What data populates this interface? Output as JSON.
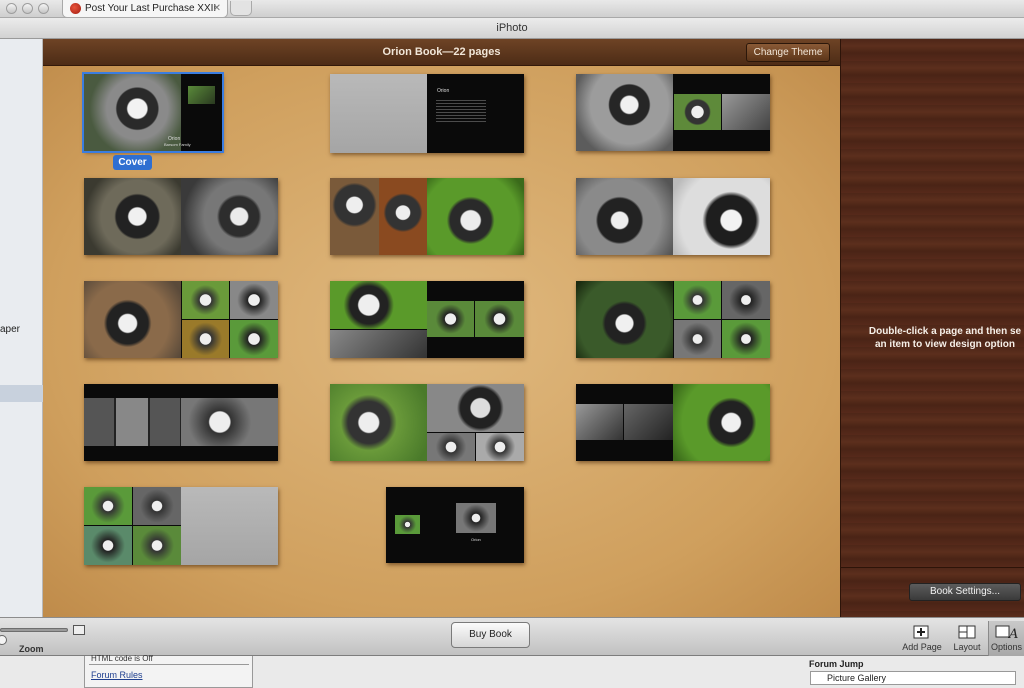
{
  "browser": {
    "tab_title": "Post Your Last Purchase XXII",
    "tab_close": "✕"
  },
  "window": {
    "title": "iPhoto"
  },
  "sidebar": {
    "partial_label": "aper"
  },
  "book": {
    "title": "Orion Book—22 pages",
    "change_theme_label": "Change Theme",
    "cover_label": "Cover",
    "cover_text_name": "Orion",
    "cover_text_sub": "Barsom Family",
    "page_title_text": "Orion",
    "last_page_caption": "Orion"
  },
  "right_panel": {
    "hint_line1": "Double-click a page and then se",
    "hint_line2": "an item to view design option",
    "book_settings_label": "Book Settings..."
  },
  "toolbar": {
    "zoom_label": "Zoom",
    "buy_book_label": "Buy Book",
    "add_page_label": "Add Page",
    "layout_label": "Layout",
    "options_label": "Options"
  },
  "forum": {
    "html_code_text": "HTML code is Off",
    "rules_link": "Forum Rules",
    "jump_label": "Forum Jump",
    "jump_selected": "Picture Gallery"
  },
  "colors": {
    "wood_light": "#d8ad6e",
    "wood_dark_header": "#5b3519",
    "right_panel": "#52281a",
    "selection_blue": "#2f6fd1"
  }
}
